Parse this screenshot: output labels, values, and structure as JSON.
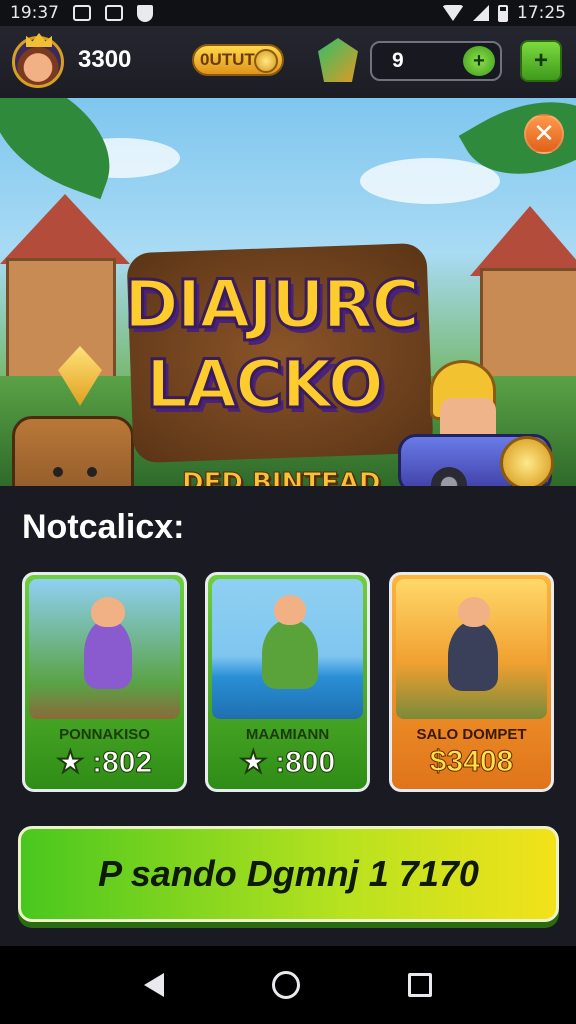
{
  "status_bar": {
    "time_left": "19:37",
    "time_right": "17:25"
  },
  "hud": {
    "player_score": "3300",
    "gold_label": "0UTUTO",
    "key_count": "9",
    "key_plus": "+",
    "menu_symbol": "+"
  },
  "banner": {
    "title_line1": "DIAJURC",
    "title_line2": "LACKO",
    "subtitle": "DED BINTEAD",
    "close_symbol": "✕"
  },
  "section": {
    "heading": "Notcalicx:"
  },
  "cards": [
    {
      "name": "PONNAKISO",
      "price": "★ :802",
      "theme": "green"
    },
    {
      "name": "MAAMIANN",
      "price": "★ :800",
      "theme": "green"
    },
    {
      "name": "SALO DOMPET",
      "price": "$3408",
      "theme": "orange"
    }
  ],
  "cta": {
    "label": "P sando Dgmnj 1 7170"
  },
  "colors": {
    "accent_green": "#4fb81f",
    "accent_orange": "#f0a030",
    "gold": "#ffcc2e"
  }
}
